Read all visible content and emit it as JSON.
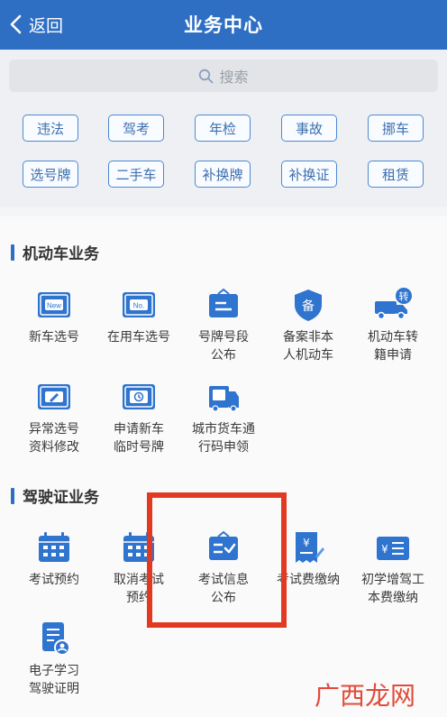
{
  "header": {
    "back_label": "返回",
    "title": "业务中心"
  },
  "search": {
    "placeholder": "搜索"
  },
  "quick_tags": [
    "违法",
    "驾考",
    "年检",
    "事故",
    "挪车",
    "选号牌",
    "二手车",
    "补换牌",
    "补换证",
    "租赁"
  ],
  "vehicle_section": {
    "title": "机动车业务",
    "items": [
      {
        "label": "新车选号",
        "icon": "new-plate-icon"
      },
      {
        "label": "在用车选号",
        "icon": "no-plate-icon"
      },
      {
        "label": "号牌号段\n公布",
        "icon": "plate-notice-icon"
      },
      {
        "label": "备案非本\n人机动车",
        "icon": "record-shield-icon"
      },
      {
        "label": "机动车转\n籍申请",
        "icon": "truck-transfer-icon"
      },
      {
        "label": "异常选号\n资料修改",
        "icon": "plate-edit-icon"
      },
      {
        "label": "申请新车\n临时号牌",
        "icon": "plate-clock-icon"
      },
      {
        "label": "城市货车通\n行码申领",
        "icon": "freight-truck-icon"
      }
    ]
  },
  "license_section": {
    "title": "驾驶证业务",
    "items": [
      {
        "label": "考试预约",
        "icon": "calendar-icon"
      },
      {
        "label": "取消考试\n预约",
        "icon": "calendar-cancel-icon"
      },
      {
        "label": "考试信息\n公布",
        "icon": "exam-notice-icon"
      },
      {
        "label": "考试费缴纳",
        "icon": "fee-receipt-icon"
      },
      {
        "label": "初学增驾工\n本费缴纳",
        "icon": "yen-list-icon"
      },
      {
        "label": "电子学习\n驾驶证明",
        "icon": "document-user-icon"
      }
    ]
  },
  "watermark": "广西龙网",
  "colors": {
    "header": "#2e6fc4",
    "icon_blue": "#2f74cf",
    "highlight": "#e23a22"
  }
}
